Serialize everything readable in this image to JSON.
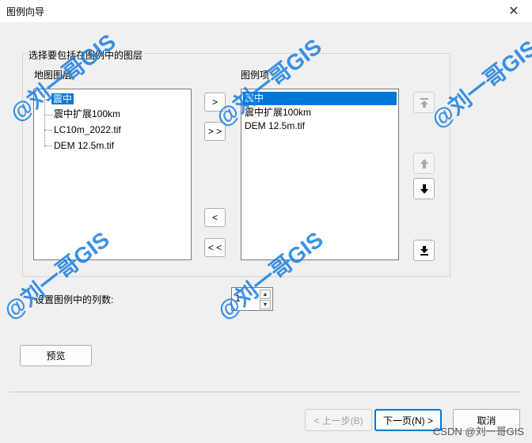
{
  "window": {
    "title": "图例向导",
    "close_glyph": "✕"
  },
  "group": {
    "title": "选择要包括在图例中的图层"
  },
  "map_layers": {
    "label": "地图图层:",
    "items": [
      "震中",
      "震中扩展100km",
      "LC10m_2022.tif",
      "DEM 12.5m.tif"
    ],
    "selected": "震中"
  },
  "legend_items": {
    "label": "图例项",
    "items": [
      "震中",
      "震中扩展100km",
      "DEM 12.5m.tif"
    ],
    "selected": "震中"
  },
  "transfer_buttons": {
    "add": ">",
    "add_all": "> >",
    "remove": "<",
    "remove_all": "< <"
  },
  "order_icons": [
    "move-top-icon",
    "move-up-icon",
    "move-down-icon",
    "move-bottom-icon"
  ],
  "columns": {
    "label": "设置图例中的列数:",
    "value": "1"
  },
  "preview_button": "预览",
  "footer": {
    "back": "< 上一步(B)",
    "next": "下一页(N) >",
    "cancel": "取消"
  },
  "watermark": {
    "text": "@刘一哥GIS",
    "csdn": "CSDN @刘一哥GIS"
  },
  "colors": {
    "selection": "#0078d7",
    "watermark": "#1a7fe0",
    "focus_border": "#0078d7"
  }
}
